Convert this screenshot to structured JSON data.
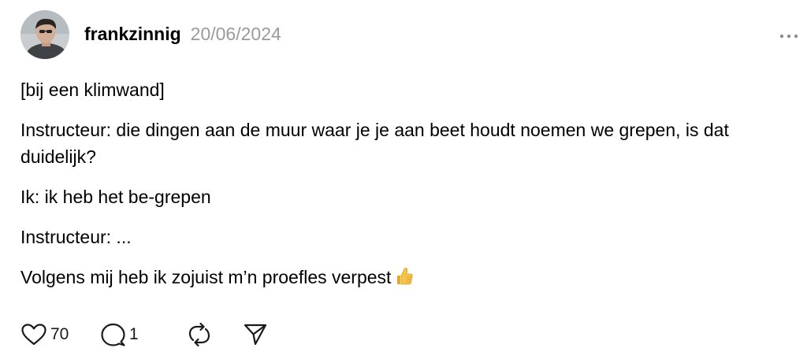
{
  "post": {
    "author": {
      "username": "frankzinnig",
      "avatar_icon": "person-avatar"
    },
    "timestamp": "20/06/2024",
    "more_icon": "ellipsis-icon",
    "body": {
      "line1": "[bij een klimwand]",
      "line2": "Instructeur: die dingen aan de muur waar je je aan beet houdt noemen we grepen, is dat duidelijk?",
      "line3": "Ik: ik heb het be-grepen",
      "line4": "Instructeur: ...",
      "line5": "Volgens mij heb ik zojuist m’n proefles verpest",
      "emoji": "thumbs-up-emoji"
    },
    "actions": {
      "like_icon": "heart-icon",
      "like_count": "70",
      "reply_icon": "speech-bubble-icon",
      "reply_count": "1",
      "repost_icon": "repost-icon",
      "share_icon": "send-icon"
    }
  },
  "colors": {
    "text": "#000000",
    "muted": "#9a9a9a",
    "icon": "#1a1a1a",
    "emoji": "#f6c34a"
  }
}
